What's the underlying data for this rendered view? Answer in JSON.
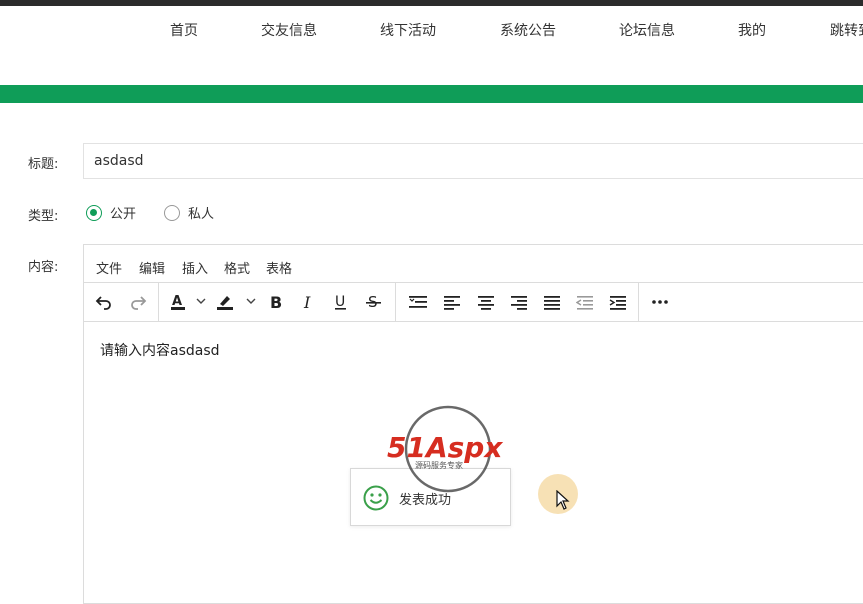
{
  "nav": {
    "items": [
      {
        "label": "首页"
      },
      {
        "label": "交友信息"
      },
      {
        "label": "线下活动"
      },
      {
        "label": "系统公告"
      },
      {
        "label": "论坛信息"
      },
      {
        "label": "我的"
      },
      {
        "label": "跳转到"
      }
    ]
  },
  "form": {
    "title_label": "标题:",
    "title_value": "asdasd",
    "type_label": "类型:",
    "type_options": [
      {
        "label": "公开",
        "checked": true
      },
      {
        "label": "私人",
        "checked": false
      }
    ],
    "content_label": "内容:"
  },
  "editor": {
    "menus": [
      "文件",
      "编辑",
      "插入",
      "格式",
      "表格"
    ],
    "toolbar": [
      "undo-icon",
      "redo-icon",
      "font-color-icon",
      "highlight-icon",
      "bold-icon",
      "italic-icon",
      "underline-icon",
      "strikethrough-icon",
      "line-height-icon",
      "align-left-icon",
      "align-center-icon",
      "align-right-icon",
      "align-justify-icon",
      "outdent-icon",
      "indent-icon",
      "more-icon"
    ],
    "content": "请输入内容asdasd"
  },
  "toast": {
    "message": "发表成功",
    "icon": "smile-icon"
  },
  "watermark": {
    "brand": "51Aspx",
    "tagline": "源码服务专家"
  },
  "colors": {
    "accent": "#0f9d58",
    "topbar": "#2b2b2b"
  }
}
